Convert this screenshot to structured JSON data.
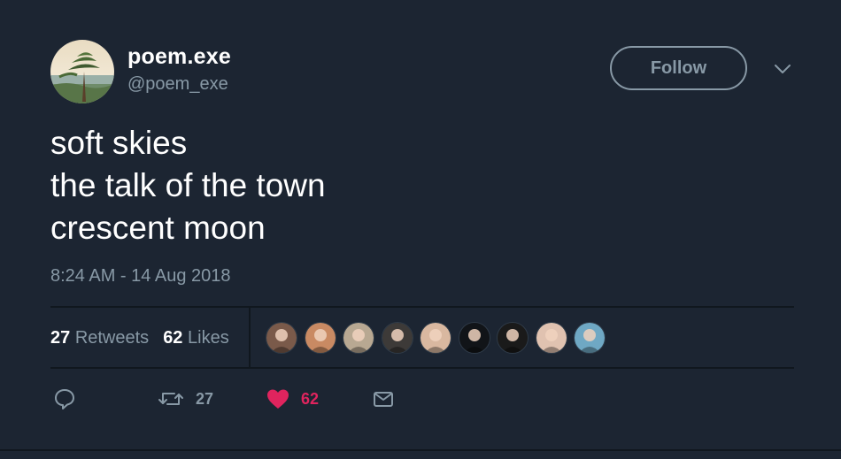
{
  "author": {
    "display_name": "poem.exe",
    "handle": "@poem_exe",
    "avatar_icon": "landscape-pine-tree-avatar"
  },
  "follow_label": "Follow",
  "tweet": {
    "lines": [
      "soft skies",
      "the talk of the town",
      "crescent moon"
    ],
    "timestamp": "8:24 AM - 14 Aug 2018"
  },
  "stats": {
    "retweets_count": "27",
    "retweets_label": "Retweets",
    "likes_count": "62",
    "likes_label": "Likes"
  },
  "liker_avatars": [
    {
      "name": "liker-avatar-1",
      "color": "#7a5a4a"
    },
    {
      "name": "liker-avatar-2",
      "color": "#c98a63"
    },
    {
      "name": "liker-avatar-3",
      "color": "#b8a892"
    },
    {
      "name": "liker-avatar-4",
      "color": "#3d3a38"
    },
    {
      "name": "liker-avatar-5",
      "color": "#d9b8a0"
    },
    {
      "name": "liker-avatar-6",
      "color": "#111418"
    },
    {
      "name": "liker-avatar-7",
      "color": "#1a1a1a"
    },
    {
      "name": "liker-avatar-8",
      "color": "#e0c2b0"
    },
    {
      "name": "liker-avatar-9",
      "color": "#6fa8c4"
    }
  ],
  "actions": {
    "retweet_count": "27",
    "like_count": "62"
  },
  "colors": {
    "background": "#1c2532",
    "secondary_text": "#8899a6",
    "like_red": "#e0245e",
    "divider": "#10171e"
  }
}
